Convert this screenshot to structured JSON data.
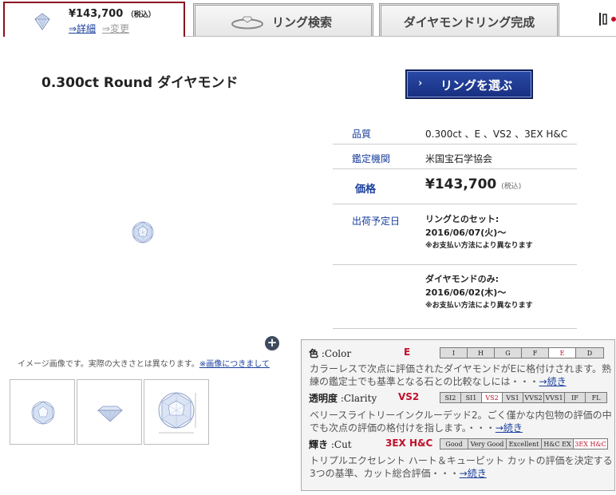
{
  "tabs": {
    "active": {
      "price": "¥143,700",
      "tax_note": "（税込）",
      "details_link": "⇒詳細",
      "change_link": "⇒変更"
    },
    "ring_search": "リング検索",
    "complete": "ダイヤモンドリング完成",
    "edge_icon": "diamond-ring-icon"
  },
  "title": "0.300ct Round ダイヤモンド",
  "choose_button": {
    "chevron": "›",
    "label": "リングを選ぶ"
  },
  "spec": {
    "quality": {
      "label": "品質",
      "value": "0.300ct 、E 、VS2 、3EX H&C"
    },
    "lab": {
      "label": "鑑定機関",
      "value": "米国宝石学協会"
    },
    "price": {
      "label": "価格",
      "value": "¥143,700",
      "tax_note": "(税込)"
    },
    "shipping": {
      "label": "出荷予定日",
      "set": {
        "title": "リングとのセット:",
        "date": "2016/06/07(火)〜",
        "note": "※お支払い方法により異なります"
      },
      "loose": {
        "title": "ダイヤモンドのみ:",
        "date": "2016/06/02(木)〜",
        "note": "※お支払い方法により異なります"
      }
    }
  },
  "image": {
    "note": "イメージ画像です。実際の大きさとは異なります。",
    "note_link": "※画像につきまして",
    "zoom_icon": "+"
  },
  "grading": {
    "color": {
      "label_jp": "色",
      "label_en": ":Color",
      "value": "E",
      "scale": [
        "I",
        "H",
        "G",
        "F",
        "E",
        "D"
      ],
      "selected": "E",
      "desc": "カラーレスで次点に評価されたダイヤモンドがEに格付けされます。熟練の鑑定士でも基準となる石との比較なしには・・・",
      "more": "→続き"
    },
    "clarity": {
      "label_jp": "透明度",
      "label_en": ":Clarity",
      "value": "VS2",
      "scale": [
        "SI2",
        "SI1",
        "VS2",
        "VS1",
        "VVS2",
        "VVS1",
        "IF",
        "FL"
      ],
      "selected": "VS2",
      "desc": "ベリースライトリーインクルーデッド2。ごく僅かな内包物の評価の中でも次点の評価の格付けを指します。・・・",
      "more": "→続き"
    },
    "cut": {
      "label_jp": "輝き",
      "label_en": ":Cut",
      "value": "3EX H&C",
      "scale": [
        "Good",
        "Very Good",
        "Excellent",
        "H&C EX",
        "3EX H&C"
      ],
      "selected": "3EX H&C",
      "desc": "トリプルエクセレント ハート＆キューピット カットの評価を決定する3つの基準、カット総合評価・・・",
      "more": "→続き"
    }
  },
  "colors": {
    "brand_navy": "#1f3a8f",
    "accent_red": "#c0102c",
    "tab_border": "#8a0e1e",
    "link_blue": "#1a3f9c"
  }
}
